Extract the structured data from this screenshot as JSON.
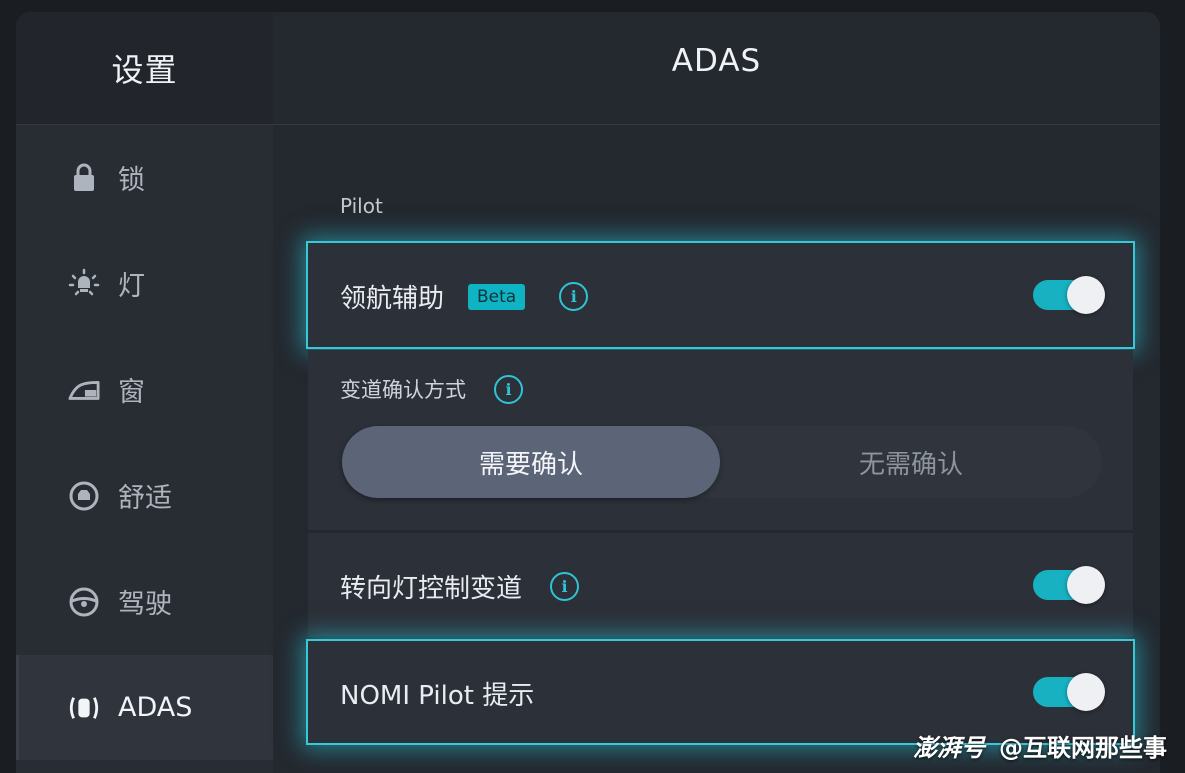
{
  "sidebar": {
    "title": "设置",
    "items": [
      {
        "label": "锁",
        "icon": "lock-icon"
      },
      {
        "label": "灯",
        "icon": "light-icon"
      },
      {
        "label": "窗",
        "icon": "window-icon"
      },
      {
        "label": "舒适",
        "icon": "comfort-icon"
      },
      {
        "label": "驾驶",
        "icon": "steering-wheel-icon"
      },
      {
        "label": "ADAS",
        "icon": "adas-icon"
      }
    ],
    "active_index": 5
  },
  "main": {
    "title": "ADAS",
    "section_label": "Pilot",
    "pilot_assist": {
      "label": "领航辅助",
      "badge": "Beta",
      "enabled": true
    },
    "lane_change": {
      "label": "变道确认方式",
      "options": [
        "需要确认",
        "无需确认"
      ],
      "selected": "需要确认"
    },
    "turn_signal": {
      "label": "转向灯控制变道",
      "enabled": true
    },
    "nomi_pilot": {
      "label": "NOMI Pilot 提示",
      "enabled": true
    }
  },
  "watermark": {
    "brand": "澎湃号",
    "author": "@互联网那些事"
  },
  "colors": {
    "accent": "#17b1c2",
    "glow": "#38c9d8",
    "background": "#24282f"
  }
}
